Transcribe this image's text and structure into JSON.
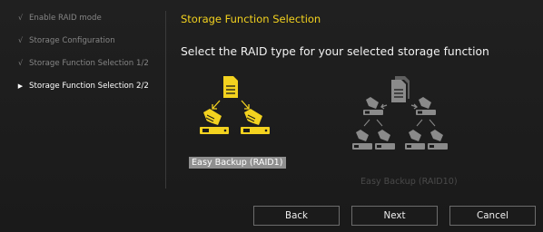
{
  "sidebar": {
    "items": [
      {
        "mark": "√",
        "label": "Enable RAID mode",
        "state": "done"
      },
      {
        "mark": "√",
        "label": "Storage Configuration",
        "state": "done"
      },
      {
        "mark": "√",
        "label": "Storage Function Selection 1/2",
        "state": "done"
      },
      {
        "mark": "▶",
        "label": "Storage Function Selection 2/2",
        "state": "active"
      }
    ]
  },
  "main": {
    "title": "Storage Function Selection",
    "subtitle": "Select the RAID type for your selected storage function",
    "options": [
      {
        "label": "Easy Backup (RAID1)",
        "selected": true,
        "icon": "raid1-diagram-icon"
      },
      {
        "label": "Easy Backup (RAID10)",
        "selected": false,
        "icon": "raid10-diagram-icon"
      }
    ]
  },
  "buttons": {
    "back": "Back",
    "next": "Next",
    "cancel": "Cancel"
  },
  "colors": {
    "accent": "#f3d21f",
    "background": "#1b1b1b",
    "disabled": "#4a4a4a"
  }
}
